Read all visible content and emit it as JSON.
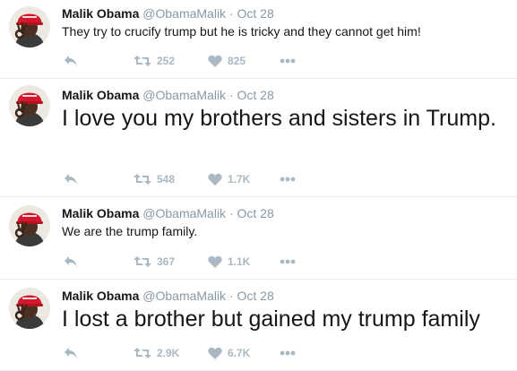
{
  "colors": {
    "hat_red": "#d3182d",
    "action_gray": "#aab8c2",
    "meta_gray": "#8899a6",
    "text": "#14171a",
    "divider": "#e6ecf0"
  },
  "tweets": [
    {
      "name": "Malik Obama",
      "handle": "@ObamaMalik",
      "separator": "·",
      "time": "Oct 28",
      "text": "They try to crucify trump but he is tricky and they cannot get him!",
      "retweets": "252",
      "likes": "825",
      "icons": [
        "avatar",
        "reply-icon",
        "retweet-icon",
        "heart-icon",
        "more-icon"
      ]
    },
    {
      "name": "Malik Obama",
      "handle": "@ObamaMalik",
      "separator": "·",
      "time": "Oct 28",
      "text": "I love you my brothers and sisters in Trump.",
      "retweets": "548",
      "likes": "1.7K",
      "icons": [
        "avatar",
        "reply-icon",
        "retweet-icon",
        "heart-icon",
        "more-icon"
      ]
    },
    {
      "name": "Malik Obama",
      "handle": "@ObamaMalik",
      "separator": "·",
      "time": "Oct 28",
      "text": "We are the trump family.",
      "retweets": "367",
      "likes": "1.1K",
      "icons": [
        "avatar",
        "reply-icon",
        "retweet-icon",
        "heart-icon",
        "more-icon"
      ]
    },
    {
      "name": "Malik Obama",
      "handle": "@ObamaMalik",
      "separator": "·",
      "time": "Oct 28",
      "text": "I lost a brother but gained my trump family",
      "retweets": "2.9K",
      "likes": "6.7K",
      "icons": [
        "avatar",
        "reply-icon",
        "retweet-icon",
        "heart-icon",
        "more-icon"
      ]
    }
  ]
}
